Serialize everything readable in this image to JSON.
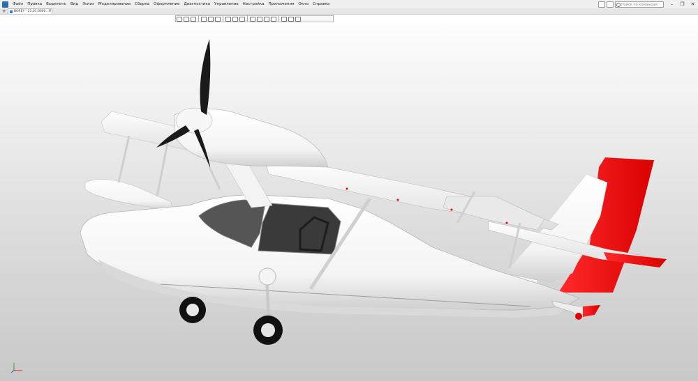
{
  "menu": {
    "items": [
      "Файл",
      "Правка",
      "Выделить",
      "Вид",
      "Эскиз",
      "Моделирование",
      "Сборка",
      "Оформление",
      "Диагностика",
      "Управление",
      "Настройка",
      "Приложения",
      "Окно",
      "Справка"
    ]
  },
  "search": {
    "placeholder": "Поиск по командам (Alt+/)"
  },
  "window_controls": {
    "minimize": "–",
    "restore": "❐",
    "close": "✕"
  },
  "tabs": {
    "add_label": "+",
    "document_label": "BOREY - 21.01.0000...",
    "close_label": "×"
  },
  "view_toolbar": {
    "icons": [
      "view-orientation",
      "zoom",
      "pan",
      "rotate",
      "display-style",
      "section",
      "measure",
      "filter"
    ]
  },
  "model": {
    "name": "seaplane-assembly",
    "colors": {
      "body": "#ffffff",
      "accent": "#ee1111",
      "propeller": "#1a1a1a",
      "canopy": "#3c3c3c"
    }
  }
}
